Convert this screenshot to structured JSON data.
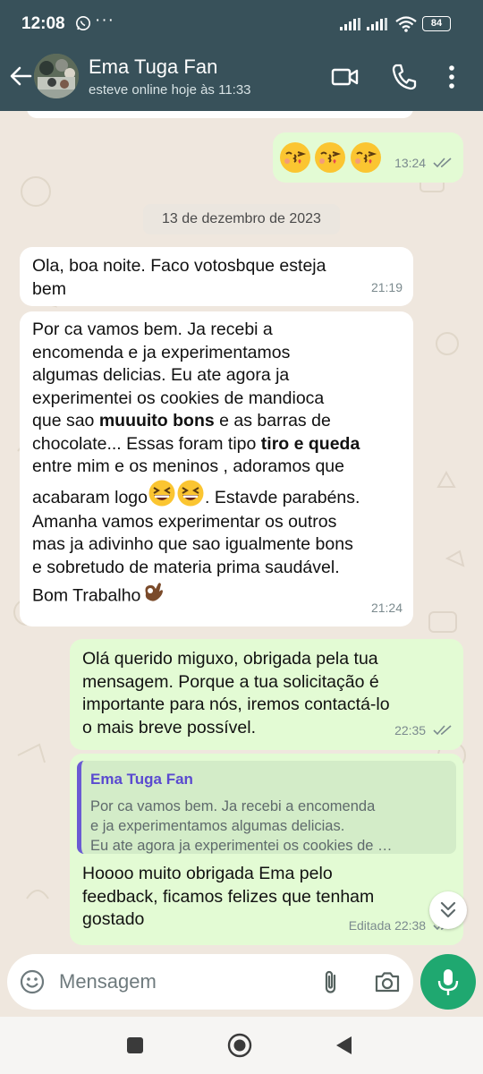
{
  "status_bar": {
    "time": "12:08",
    "more": "···",
    "battery": "84"
  },
  "header": {
    "contact_name": "Ema Tuga Fan",
    "contact_status": "esteve online hoje às 11:33"
  },
  "messages": [
    {
      "direction": "out",
      "emoji": [
        "face-blowing-kiss",
        "face-blowing-kiss",
        "face-blowing-kiss"
      ],
      "time": "13:24",
      "status": "read"
    },
    {
      "direction": "in",
      "text": "Ola, boa noite. Faco votosbque esteja\nbem",
      "time": "21:19"
    },
    {
      "direction": "in",
      "line1": "Por ca vamos bem. Ja recebi a",
      "line2": "encomenda e ja experimentamos",
      "line3": "algumas delicias. Eu ate agora ja",
      "line4": "experimentei os cookies de mandioca",
      "line5_pre": "que sao ",
      "line5_bold": "muuuito bons",
      "line5_post": " e as barras de",
      "line6_pre": "chocolate... Essas foram tipo ",
      "line6_bold": "tiro e queda",
      "line7": "entre mim e os meninos , adoramos que",
      "line8_pre": "acabaram logo",
      "line8_post": ". Estavde parabéns.",
      "line9": "Amanha vamos experimentar os outros",
      "line10": "mas ja adivinho que sao igualmente bons",
      "line11": "e sobretudo de materia prima saudável.",
      "line12": "Bom Trabalho",
      "time": "21:24"
    },
    {
      "direction": "out",
      "text": "Olá querido miguxo, obrigada pela tua\nmensagem. Porque a tua solicitação é\nimportante para nós, iremos contactá-lo\no mais breve possível.",
      "time": "22:35",
      "status": "read"
    },
    {
      "direction": "out",
      "quote_author": "Ema Tuga Fan",
      "quote_text": "Por ca vamos bem. Ja recebi a encomenda\ne ja experimentamos algumas delicias.\nEu ate agora ja experimentei os cookies de …",
      "text": "Hoooo muito obrigada Ema pelo\nfeedback, ficamos felizes que tenham\ngostado",
      "edited_label": "Editada",
      "time": "22:38",
      "status": "read"
    }
  ],
  "date_separator": "13 de dezembro de 2023",
  "composer": {
    "placeholder": "Mensagem"
  },
  "colors": {
    "header": "#38515a",
    "incoming_bubble": "#ffffff",
    "outgoing_bubble": "#e3fbd4",
    "mic_button": "#1fa870",
    "quote_accent": "#6a5bd3"
  }
}
